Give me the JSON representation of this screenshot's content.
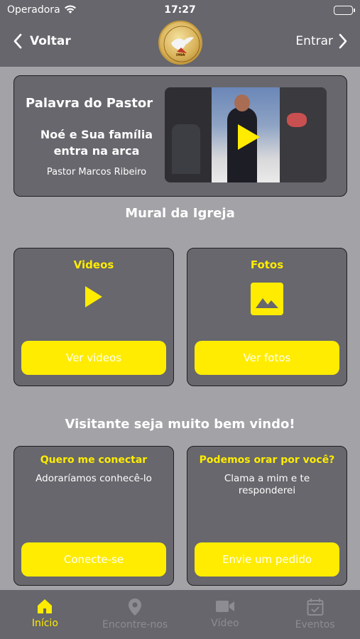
{
  "status_bar": {
    "carrier": "Operadora",
    "time": "17:27"
  },
  "nav": {
    "back_label": "Voltar",
    "enter_label": "Entrar"
  },
  "pastor_card": {
    "title": "Palavra do Pastor",
    "sermon_title": "Noé e Sua família entra na arca",
    "preacher": "Pastor Marcos Ribeiro"
  },
  "mural": {
    "title": "Mural da Igreja",
    "videos": {
      "title": "Videos",
      "button": "Ver videos",
      "icon": "play-icon"
    },
    "fotos": {
      "title": "Fotos",
      "button": "Ver fotos",
      "icon": "image-icon"
    }
  },
  "welcome": {
    "title": "Visitante seja muito bem vindo!",
    "connect": {
      "title": "Quero me conectar",
      "text": "Adoraríamos conhecê-lo",
      "button": "Conecte-se"
    },
    "pray": {
      "title": "Podemos orar por você?",
      "text": "Clama a mim e te responderei",
      "button": "Envie um pedido"
    }
  },
  "tabs": [
    {
      "label": "Início",
      "icon": "home-icon",
      "active": true
    },
    {
      "label": "Encontre-nos",
      "icon": "location-pin-icon",
      "active": false
    },
    {
      "label": "Vídeo",
      "icon": "video-camera-icon",
      "active": false
    },
    {
      "label": "Eventos",
      "icon": "calendar-icon",
      "active": false
    }
  ],
  "colors": {
    "accent": "#ffec00",
    "bar": "#66666c",
    "card": "#67676d",
    "background": "#a3a3a7",
    "inactive": "#8c8c92"
  }
}
